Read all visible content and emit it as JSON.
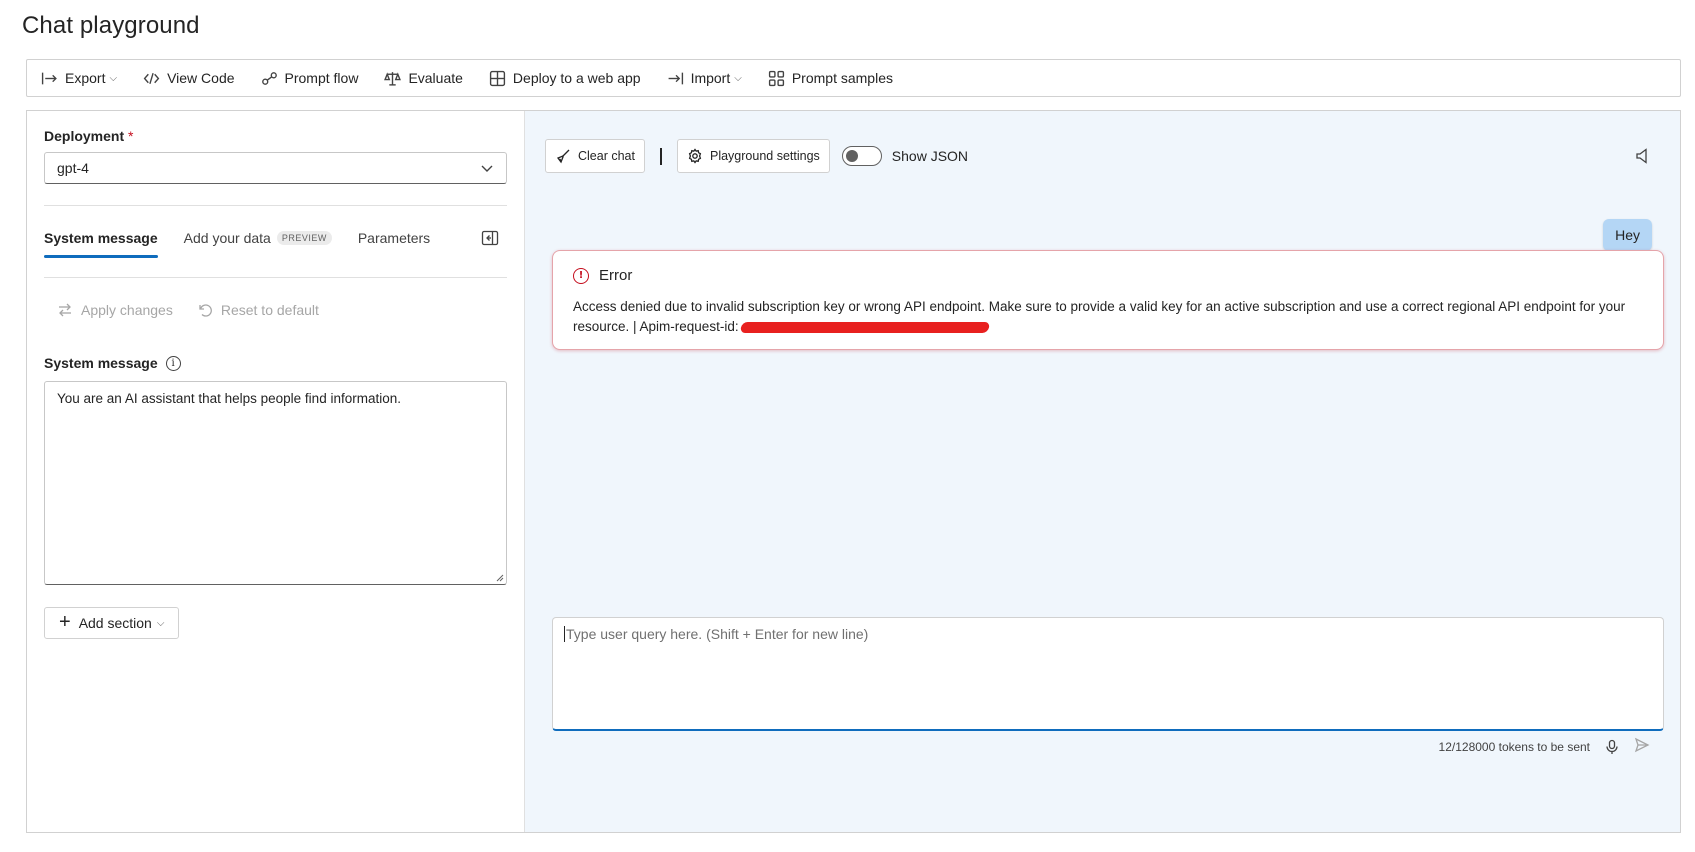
{
  "page": {
    "title": "Chat playground"
  },
  "toolbar": {
    "items": [
      {
        "label": "Export",
        "icon": "export-icon",
        "caret": "⌵"
      },
      {
        "label": "View Code",
        "icon": "code-icon"
      },
      {
        "label": "Prompt flow",
        "icon": "flow-icon"
      },
      {
        "label": "Evaluate",
        "icon": "scale-icon"
      },
      {
        "label": "Deploy to a web app",
        "icon": "deploy-icon"
      },
      {
        "label": "Import",
        "icon": "import-icon",
        "caret": "⌵"
      },
      {
        "label": "Prompt samples",
        "icon": "grid-icon"
      }
    ]
  },
  "left_panel": {
    "deployment_label": "Deployment",
    "required_mark": "*",
    "deployment_value": "gpt-4",
    "tabs": [
      {
        "label": "System message",
        "active": true
      },
      {
        "label": "Add your data",
        "badge": "PREVIEW"
      },
      {
        "label": "Parameters"
      }
    ],
    "apply_changes": "Apply changes",
    "reset_default": "Reset to default",
    "system_message_label": "System message",
    "info_glyph": "i",
    "system_message_value": "You are an AI assistant that helps people find information.",
    "add_section": "Add section",
    "add_caret": "⌵"
  },
  "chat": {
    "clear_chat": "Clear chat",
    "playground_settings": "Playground settings",
    "show_json": "Show JSON",
    "show_json_on": false,
    "user_message": "Hey",
    "error": {
      "title": "Error",
      "icon_glyph": "!",
      "message": "Access denied due to invalid subscription key or wrong API endpoint. Make sure to provide a valid key for an active subscription and use a correct regional API endpoint for your resource. | Apim-request-id:"
    },
    "query_placeholder": "Type user query here. (Shift + Enter for new line)",
    "token_status": "12/128000 tokens to be sent"
  },
  "colors": {
    "accent": "#0f6cbd",
    "error": "#c50f1f",
    "user_bubble": "#b4d6f5",
    "chat_bg": "#f0f6fc"
  }
}
